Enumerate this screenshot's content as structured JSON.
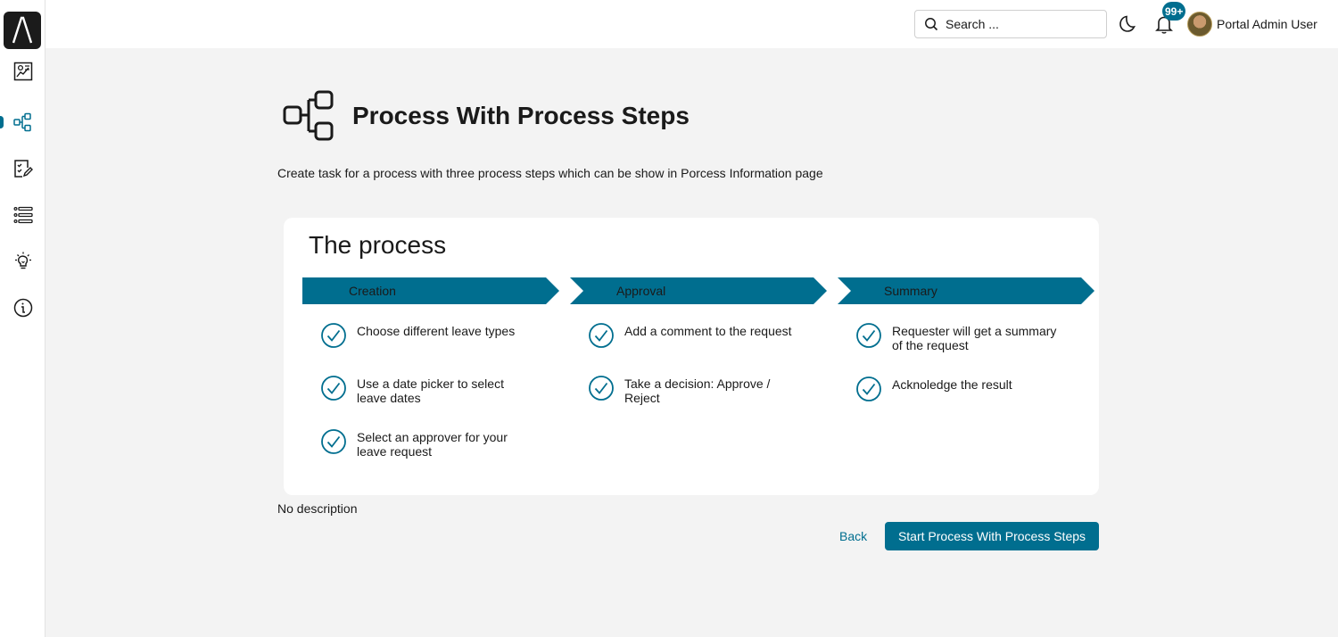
{
  "header": {
    "search_placeholder": "Search ...",
    "notification_badge": "99+",
    "user_name": "Portal Admin User"
  },
  "sidebar": {
    "items": [
      {
        "name": "dashboard",
        "icon": "dashboard-chart-icon"
      },
      {
        "name": "processes",
        "icon": "process-tree-icon",
        "active": true
      },
      {
        "name": "tasks",
        "icon": "task-edit-icon"
      },
      {
        "name": "cases",
        "icon": "list-icon"
      },
      {
        "name": "ideas",
        "icon": "lightbulb-icon"
      },
      {
        "name": "about",
        "icon": "info-icon"
      }
    ]
  },
  "main": {
    "title": "Process With Process Steps",
    "description": "Create task for a process with three process steps which can be show in Porcess Information page",
    "card_title": "The process",
    "steps": [
      {
        "label": "Creation",
        "items": [
          "Choose different leave types",
          "Use a date picker to select leave dates",
          "Select an approver for your leave request"
        ]
      },
      {
        "label": "Approval",
        "items": [
          "Add a comment to the request",
          "Take a decision: Approve / Reject"
        ]
      },
      {
        "label": "Summary",
        "items": [
          "Requester will get a summary of the request",
          "Acknoledge the result"
        ]
      }
    ],
    "no_description": "No description",
    "back_label": "Back",
    "start_label": "Start Process With Process Steps"
  },
  "colors": {
    "accent": "#006e8f",
    "background": "#f3f3f3",
    "card": "#ffffff"
  }
}
